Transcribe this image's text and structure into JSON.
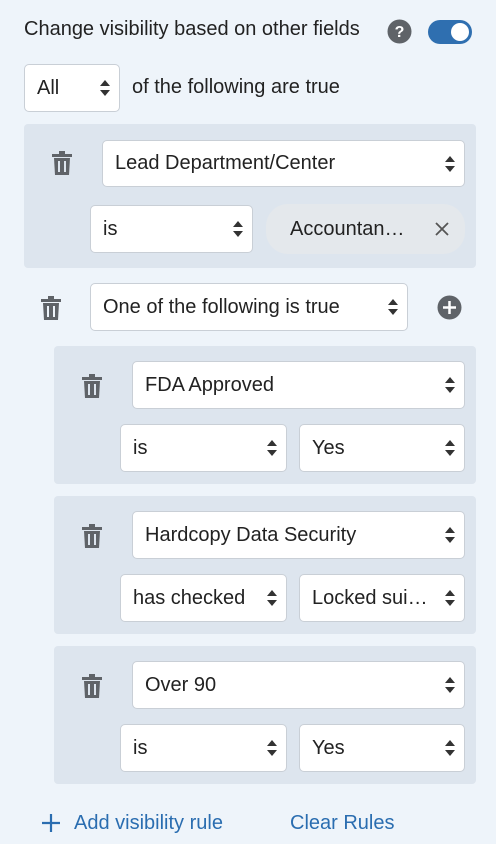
{
  "header": {
    "title": "Change visibility based on other fields",
    "help_icon": "question-circle-icon",
    "toggle_on": true
  },
  "match": {
    "quantifier": "All",
    "suffix": "of the following are true"
  },
  "rule1": {
    "field": "Lead Department/Center",
    "operator": "is",
    "value_chip": "Accountan…"
  },
  "group": {
    "condition": "One of the following is true",
    "rules": [
      {
        "field": "FDA Approved",
        "operator": "is",
        "value": "Yes"
      },
      {
        "field": "Hardcopy Data Security",
        "operator": "has checked",
        "value": "Locked sui…"
      },
      {
        "field": "Over 90",
        "operator": "is",
        "value": "Yes"
      }
    ]
  },
  "footer": {
    "add_label": "Add visibility rule",
    "clear_label": "Clear Rules"
  },
  "colors": {
    "accent": "#2a6db0",
    "toggle": "#2f6fb0",
    "panel": "#dde5ee",
    "background": "#eef4fa"
  }
}
